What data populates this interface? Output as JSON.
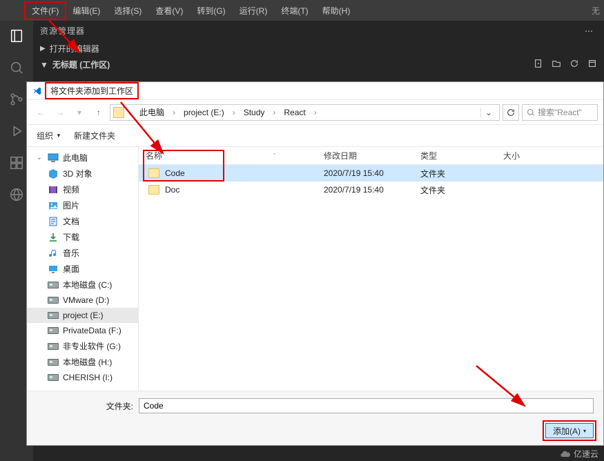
{
  "menubar": {
    "items": [
      {
        "label": "文件(F)"
      },
      {
        "label": "编辑(E)"
      },
      {
        "label": "选择(S)"
      },
      {
        "label": "查看(V)"
      },
      {
        "label": "转到(G)"
      },
      {
        "label": "运行(R)"
      },
      {
        "label": "终端(T)"
      },
      {
        "label": "帮助(H)"
      }
    ],
    "title_right": "无"
  },
  "sidepanel": {
    "title": "资源管理器",
    "open_editors": "打开的编辑器",
    "workspace": "无标题 (工作区)"
  },
  "dialog": {
    "title": "将文件夹添加到工作区",
    "breadcrumb": {
      "root": "此电脑",
      "parts": [
        "project (E:)",
        "Study",
        "React"
      ]
    },
    "search_placeholder": "搜索\"React\"",
    "toolbar": {
      "organize": "组织",
      "new_folder": "新建文件夹"
    },
    "tree": {
      "root": "此电脑",
      "children": [
        {
          "label": "3D 对象",
          "icon": "cube"
        },
        {
          "label": "视频",
          "icon": "film"
        },
        {
          "label": "图片",
          "icon": "image"
        },
        {
          "label": "文档",
          "icon": "doc"
        },
        {
          "label": "下载",
          "icon": "download"
        },
        {
          "label": "音乐",
          "icon": "music"
        },
        {
          "label": "桌面",
          "icon": "desktop"
        },
        {
          "label": "本地磁盘 (C:)",
          "icon": "disk"
        },
        {
          "label": "VMware (D:)",
          "icon": "disk"
        },
        {
          "label": "project (E:)",
          "icon": "disk",
          "selected": true
        },
        {
          "label": "PrivateData (F:)",
          "icon": "disk"
        },
        {
          "label": "非专业软件 (G:)",
          "icon": "disk"
        },
        {
          "label": "本地磁盘 (H:)",
          "icon": "disk"
        },
        {
          "label": "CHERISH (I:)",
          "icon": "disk"
        }
      ]
    },
    "columns": {
      "name": "名称",
      "date": "修改日期",
      "type": "类型",
      "size": "大小"
    },
    "rows": [
      {
        "name": "Code",
        "date": "2020/7/19 15:40",
        "type": "文件夹",
        "selected": true
      },
      {
        "name": "Doc",
        "date": "2020/7/19 15:40",
        "type": "文件夹"
      }
    ],
    "footer": {
      "folder_label": "文件夹:",
      "folder_value": "Code",
      "add_button": "添加(A)"
    }
  },
  "watermark": "亿速云"
}
